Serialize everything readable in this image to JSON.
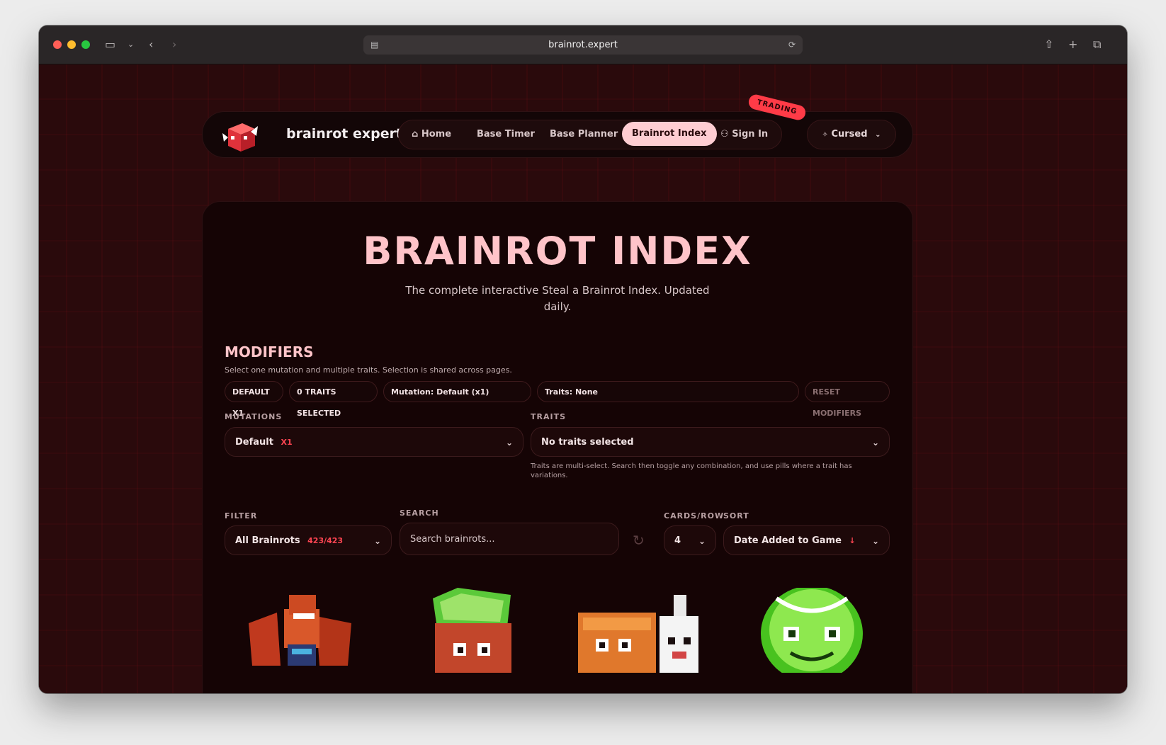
{
  "browser": {
    "url": "brainrot.expert"
  },
  "nav": {
    "brand": "brainrot expert",
    "links": [
      "Home",
      "Base Timer",
      "Base Planner",
      "Brainrot Index",
      "Sign In"
    ],
    "badge": "TRADING",
    "theme": "Cursed"
  },
  "hero": {
    "title": "BRAINROT INDEX",
    "subtitle": "The complete interactive Steal a Brainrot Index. Updated daily."
  },
  "modifiers": {
    "heading": "MODIFIERS",
    "description": "Select one mutation and multiple traits. Selection is shared across pages.",
    "chips": [
      "DEFAULT X1",
      "0 TRAITS SELECTED",
      "Mutation: Default (x1)",
      "Traits: None",
      "RESET MODIFIERS"
    ],
    "mutations_label": "MUTATIONS",
    "mutation_value": "Default",
    "mutation_multiplier": "X1",
    "traits_label": "TRAITS",
    "traits_value": "No traits selected",
    "traits_hint": "Traits are multi-select. Search then toggle any combination, and use pills where a trait has variations."
  },
  "controls": {
    "filter_label": "FILTER",
    "filter_value": "All Brainrots",
    "filter_count": "423/423",
    "search_label": "SEARCH",
    "search_placeholder": "Search brainrots...",
    "cards_label": "CARDS/ROW",
    "cards_value": "4",
    "sort_label": "SORT",
    "sort_value": "Date Added to Game"
  },
  "colors": {
    "accent": "#ff4552",
    "title": "#ffc4c9",
    "active_nav": "#ffcdd2",
    "background": "#0e0405"
  }
}
